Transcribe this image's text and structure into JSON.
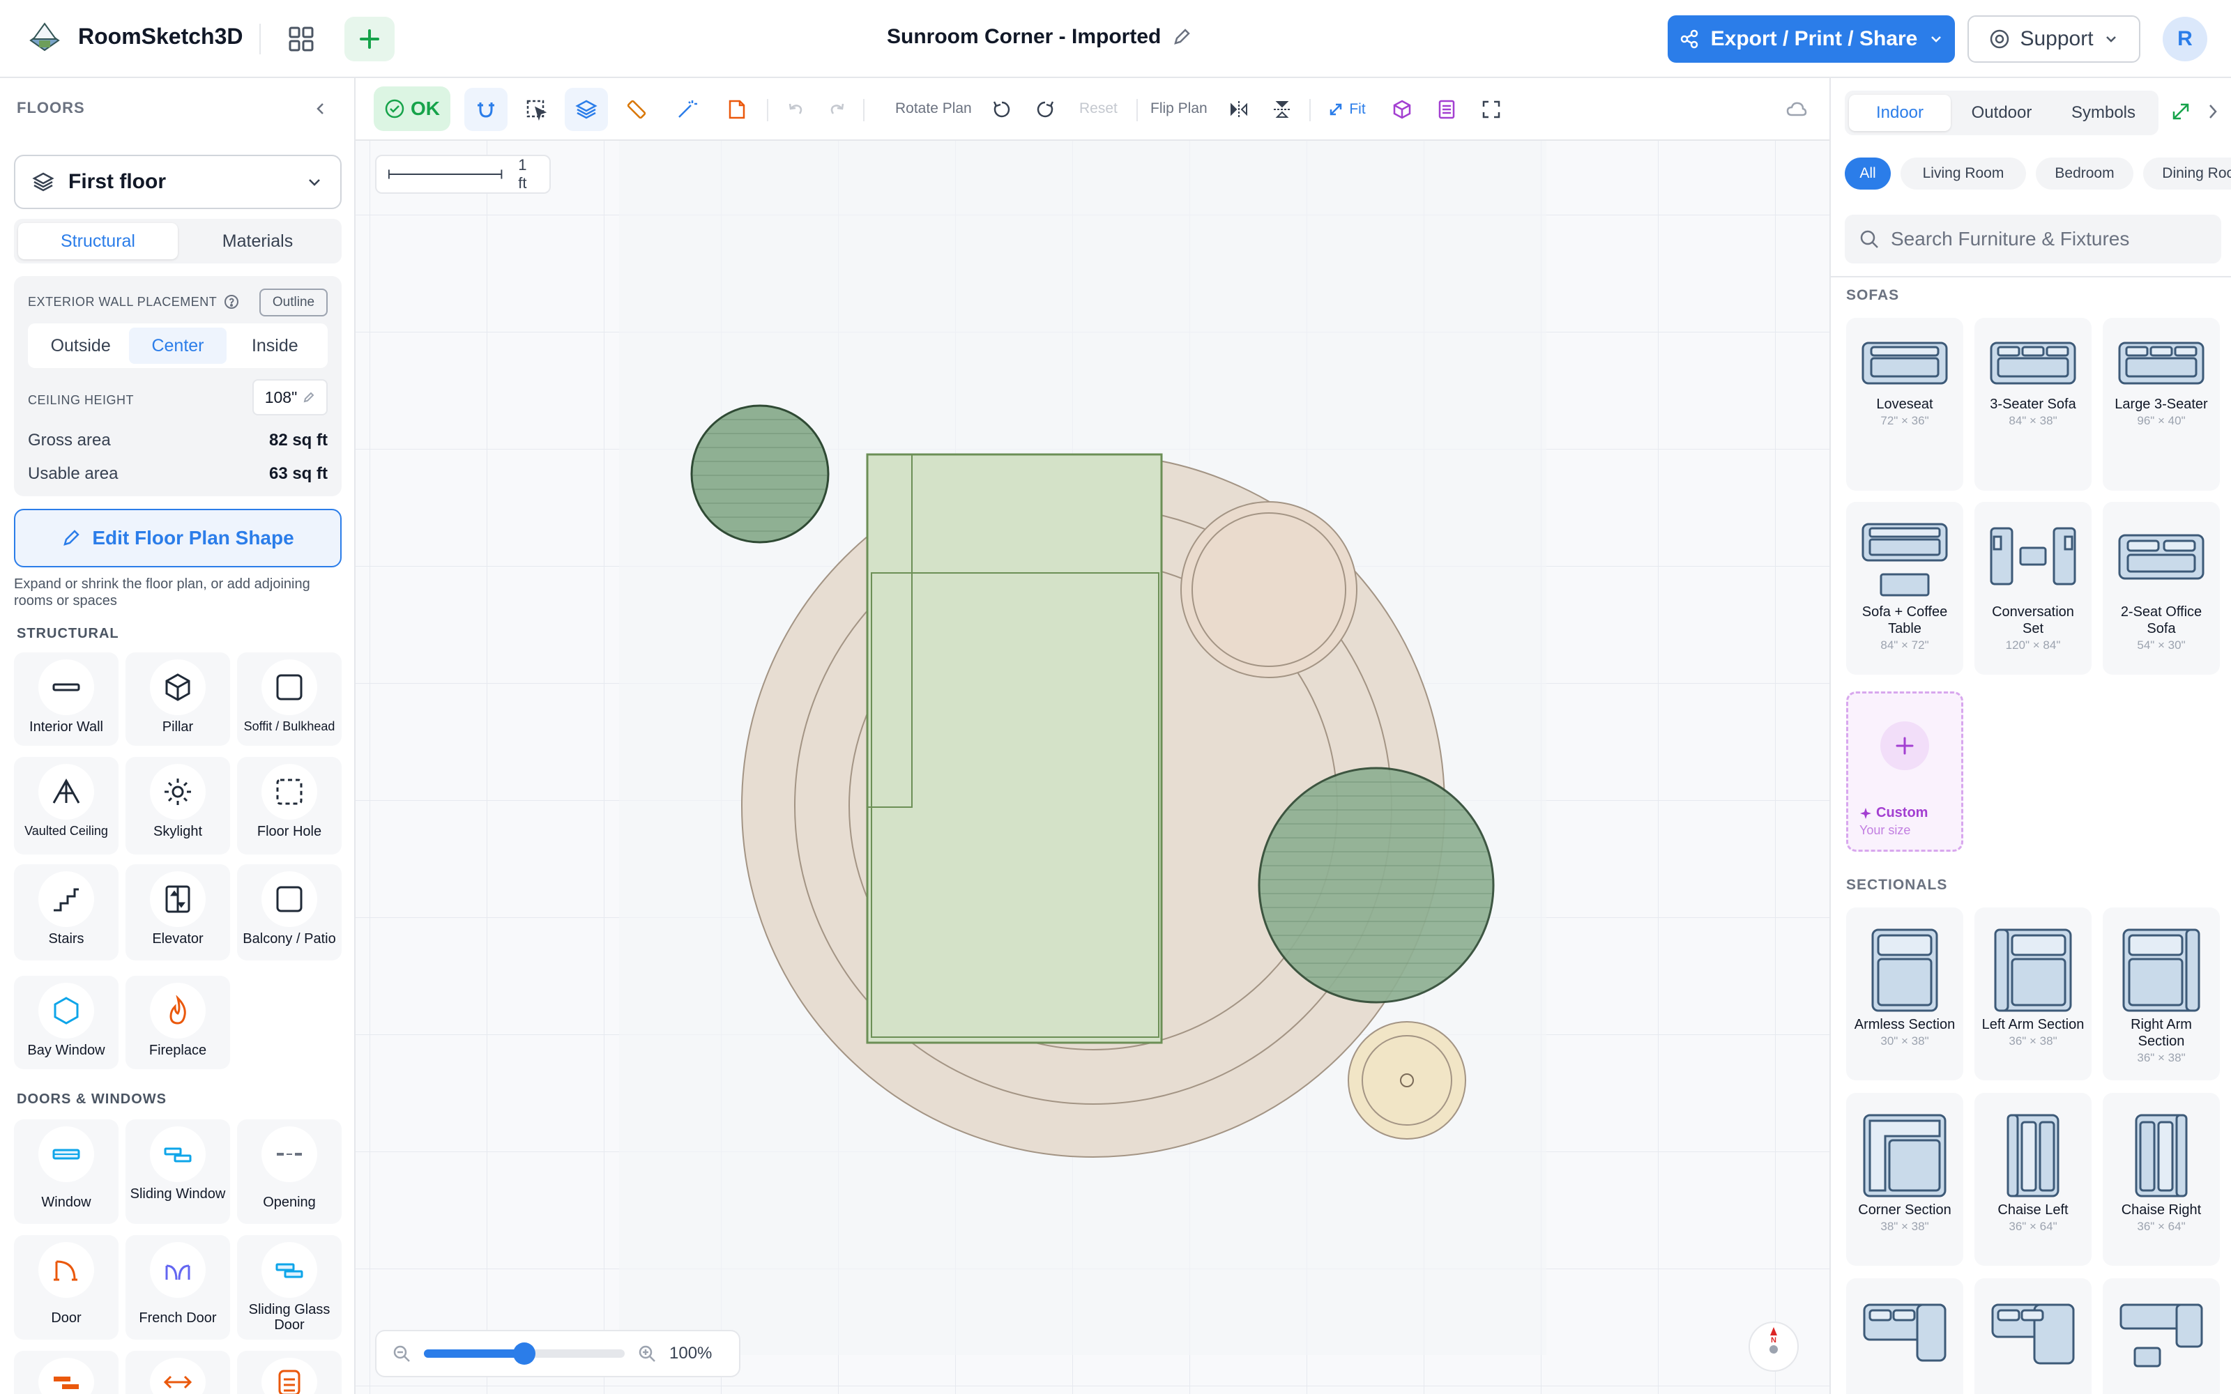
{
  "header": {
    "app_name": "RoomSketch3D",
    "doc_title": "Sunroom Corner - Imported",
    "export_label": "Export / Print / Share",
    "support_label": "Support",
    "avatar_initial": "R"
  },
  "left": {
    "title": "FLOORS",
    "floor_select": "First floor",
    "tabs": [
      "Structural",
      "Materials"
    ],
    "active_tab": "Structural",
    "exterior_wall_label": "EXTERIOR WALL PLACEMENT",
    "outline_label": "Outline",
    "placement": [
      "Outside",
      "Center",
      "Inside"
    ],
    "active_placement": "Center",
    "ceiling_label": "CEILING HEIGHT",
    "ceiling_value": "108\"",
    "gross_label": "Gross area",
    "gross_value": "82 sq ft",
    "usable_label": "Usable area",
    "usable_value": "63 sq ft",
    "edit_label": "Edit Floor Plan Shape",
    "edit_note": "Expand or shrink the floor plan, or add adjoining rooms or spaces",
    "structural_title": "STRUCTURAL",
    "structural": [
      {
        "label": "Interior Wall",
        "icon": "interior-wall-icon"
      },
      {
        "label": "Pillar",
        "icon": "pillar-icon"
      },
      {
        "label": "Soffit / Bulkhead",
        "icon": "soffit-icon"
      },
      {
        "label": "Vaulted Ceiling",
        "icon": "vaulted-ceiling-icon"
      },
      {
        "label": "Skylight",
        "icon": "skylight-icon"
      },
      {
        "label": "Floor Hole",
        "icon": "floor-hole-icon"
      },
      {
        "label": "Stairs",
        "icon": "stairs-icon"
      },
      {
        "label": "Elevator",
        "icon": "elevator-icon"
      },
      {
        "label": "Balcony / Patio",
        "icon": "balcony-icon"
      },
      {
        "label": "Bay Window",
        "icon": "bay-window-icon"
      },
      {
        "label": "Fireplace",
        "icon": "fireplace-icon"
      }
    ],
    "doors_title": "DOORS & WINDOWS",
    "doors": [
      {
        "label": "Window",
        "icon": "window-icon"
      },
      {
        "label": "Sliding Window",
        "icon": "sliding-window-icon"
      },
      {
        "label": "Opening",
        "icon": "opening-icon"
      },
      {
        "label": "Door",
        "icon": "door-icon"
      },
      {
        "label": "French Door",
        "icon": "french-door-icon"
      },
      {
        "label": "Sliding Glass Door",
        "icon": "sliding-glass-door-icon"
      }
    ]
  },
  "canvas": {
    "ok_label": "OK",
    "rotate_label": "Rotate Plan",
    "reset_label": "Reset",
    "flip_label": "Flip Plan",
    "fit_label": "Fit",
    "scale_label": "1 ft",
    "zoom_value": "100%",
    "zoom_fraction": 0.5,
    "compass_label": "N"
  },
  "right": {
    "tabs": [
      "Indoor",
      "Outdoor",
      "Symbols"
    ],
    "active_tab": "Indoor",
    "chips": [
      "All",
      "Living Room",
      "Bedroom",
      "Dining Room"
    ],
    "active_chip": "All",
    "search_placeholder": "Search Furniture & Fixtures",
    "sofas_title": "SOFAS",
    "sofas": [
      {
        "name": "Loveseat",
        "dims": "72\" × 36\""
      },
      {
        "name": "3-Seater Sofa",
        "dims": "84\" × 38\""
      },
      {
        "name": "Large 3-Seater",
        "dims": "96\" × 40\""
      },
      {
        "name": "Sofa + Coffee Table",
        "dims": "84\" × 72\""
      },
      {
        "name": "Conversation Set",
        "dims": "120\" × 84\""
      },
      {
        "name": "2-Seat Office Sofa",
        "dims": "54\" × 30\""
      }
    ],
    "custom_label": "Custom",
    "custom_sub": "Your size",
    "sectionals_title": "SECTIONALS",
    "sectionals": [
      {
        "name": "Armless Section",
        "dims": "30\" × 38\""
      },
      {
        "name": "Left Arm Section",
        "dims": "36\" × 38\""
      },
      {
        "name": "Right Arm Section",
        "dims": "36\" × 38\""
      },
      {
        "name": "Corner Section",
        "dims": "38\" × 38\""
      },
      {
        "name": "Chaise Left",
        "dims": "36\" × 64\""
      },
      {
        "name": "Chaise Right",
        "dims": "36\" × 64\""
      }
    ]
  },
  "colors": {
    "accent": "#2b7de9",
    "ok_green": "#16a34a",
    "rug": "#e7ddd2",
    "plant": "#8fb093",
    "bed": "#d4e2c8",
    "custom_purple": "#a33fd1"
  }
}
